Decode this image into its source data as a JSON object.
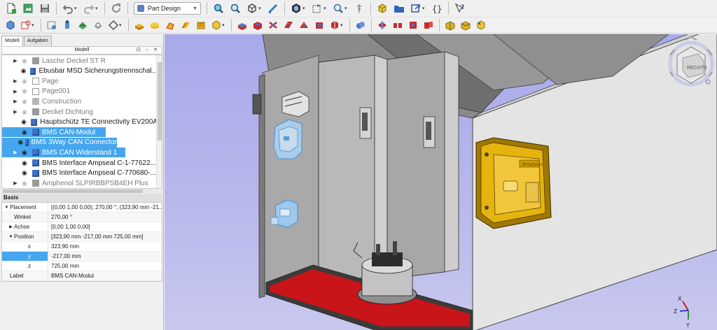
{
  "toolbar": {
    "workbench": "Part Design"
  },
  "panel": {
    "tabs": [
      "Modell",
      "Aufgaben"
    ],
    "model_header": "Modell",
    "tree": [
      {
        "label": "Lasche Deckel ST R",
        "expander": true,
        "visible": false,
        "icon": "part-grey",
        "selected": false,
        "dim": true
      },
      {
        "label": "Ebusbar MSD Sicherungstrennschal...",
        "expander": false,
        "visible": true,
        "icon": "part",
        "selected": false,
        "dim": false
      },
      {
        "label": "Page",
        "expander": true,
        "visible": false,
        "icon": "page",
        "selected": false,
        "dim": true
      },
      {
        "label": "Page001",
        "expander": true,
        "visible": false,
        "icon": "page",
        "selected": false,
        "dim": true
      },
      {
        "label": "Construction",
        "expander": true,
        "visible": false,
        "icon": "folder",
        "selected": false,
        "dim": true
      },
      {
        "label": "Deckel Dichtung",
        "expander": true,
        "visible": false,
        "icon": "part-grey",
        "selected": false,
        "dim": true
      },
      {
        "label": "Hauptschütz TE Connectivity EV200A",
        "expander": false,
        "visible": true,
        "icon": "part",
        "selected": false,
        "dim": false
      },
      {
        "label": "BMS CAN-Modul",
        "expander": false,
        "visible": true,
        "icon": "part",
        "selected": true,
        "dim": false
      },
      {
        "label": "BMS 3Way CAN Connector",
        "expander": false,
        "visible": true,
        "icon": "part",
        "selected": true,
        "dim": false
      },
      {
        "label": "BMS CAN Widerstand 1",
        "expander": true,
        "visible": true,
        "icon": "part",
        "selected": true,
        "dim": false
      },
      {
        "label": "BMS Interface Ampseal C-1-77622...",
        "expander": false,
        "visible": true,
        "icon": "part",
        "selected": false,
        "dim": false
      },
      {
        "label": "BMS Interface Ampseal C-770680-...",
        "expander": false,
        "visible": true,
        "icon": "part",
        "selected": false,
        "dim": false
      },
      {
        "label": "Amphenol SLPIRBBPSB4EH Plus",
        "expander": true,
        "visible": false,
        "icon": "part-grey",
        "selected": false,
        "dim": true
      }
    ],
    "properties": {
      "group": "Basis",
      "rows": [
        {
          "key": "Placement",
          "value": "[(0,00 1,00 0,00); 270,00 °; (323,90 mm  -21...",
          "level": 0,
          "expander": "open"
        },
        {
          "key": "Winkel",
          "value": "270,00 °",
          "level": 1,
          "expander": ""
        },
        {
          "key": "Achse",
          "value": "[0,00 1,00 0,00]",
          "level": 1,
          "expander": "closed"
        },
        {
          "key": "Position",
          "value": "[323,90 mm  -217,00 mm  725,00 mm]",
          "level": 1,
          "expander": "open"
        },
        {
          "key": "x",
          "value": "323,90 mm",
          "level": 2,
          "expander": ""
        },
        {
          "key": "y",
          "value": "-217,00 mm",
          "level": 2,
          "expander": "",
          "selected": true
        },
        {
          "key": "z",
          "value": "725,00 mm",
          "level": 2,
          "expander": ""
        },
        {
          "key": "Label",
          "value": "BMS CAN-Modul",
          "level": 0,
          "expander": ""
        }
      ]
    }
  },
  "viewport": {
    "navcube_face": "RECHTS",
    "axis_labels": {
      "x": "X",
      "y": "Y",
      "z": "Z"
    },
    "label_plate_text": "Amphenol",
    "colors": {
      "selection": "#45a6ee",
      "highlight_yellow": "#e5b40f",
      "floor_red": "#c9141a"
    }
  }
}
